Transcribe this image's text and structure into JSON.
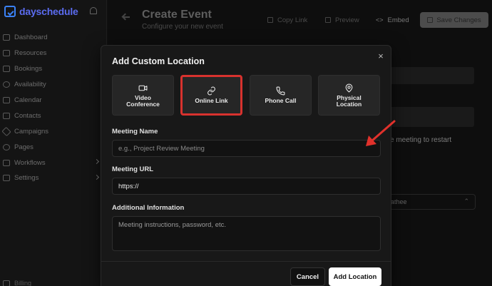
{
  "app": {
    "logo": "dayschedule"
  },
  "sidebar": {
    "items": [
      {
        "label": "Dashboard",
        "icon": "chart-icon",
        "chevron": false
      },
      {
        "label": "Resources",
        "icon": "folder-icon",
        "chevron": false
      },
      {
        "label": "Bookings",
        "icon": "calendar-check-icon",
        "chevron": false
      },
      {
        "label": "Availability",
        "icon": "clock-icon",
        "chevron": false
      },
      {
        "label": "Calendar",
        "icon": "calendar-icon",
        "chevron": false
      },
      {
        "label": "Contacts",
        "icon": "contacts-icon",
        "chevron": false
      },
      {
        "label": "Campaigns",
        "icon": "rocket-icon",
        "chevron": false
      },
      {
        "label": "Pages",
        "icon": "globe-icon",
        "chevron": false
      },
      {
        "label": "Workflows",
        "icon": "flow-icon",
        "chevron": true
      },
      {
        "label": "Settings",
        "icon": "sliders-icon",
        "chevron": true
      }
    ],
    "billing": "Billing"
  },
  "header": {
    "title": "Create Event",
    "subtitle": "Configure your new event",
    "copy_link": "Copy Link",
    "preview": "Preview",
    "embed": "Embed",
    "save": "Save Changes"
  },
  "background": {
    "restart_text": "e meeting to restart",
    "select_text": "athee"
  },
  "modal": {
    "title": "Add Custom Location",
    "close": "×",
    "options": [
      {
        "label": "Video\nConference",
        "icon": "video-camera-icon",
        "selected": false
      },
      {
        "label": "Online Link",
        "icon": "link-icon",
        "selected": true
      },
      {
        "label": "Phone Call",
        "icon": "phone-icon",
        "selected": false
      },
      {
        "label": "Physical\nLocation",
        "icon": "map-pin-icon",
        "selected": false
      }
    ],
    "meeting_name_label": "Meeting Name",
    "meeting_name_placeholder": "e.g., Project Review Meeting",
    "meeting_url_label": "Meeting URL",
    "meeting_url_value": "https://",
    "additional_label": "Additional Information",
    "additional_placeholder": "Meeting instructions, password, etc.",
    "cancel": "Cancel",
    "add": "Add Location"
  },
  "colors": {
    "accent": "#5b6cf0",
    "highlight": "#d8322e",
    "primary_button": "#ffffff"
  }
}
